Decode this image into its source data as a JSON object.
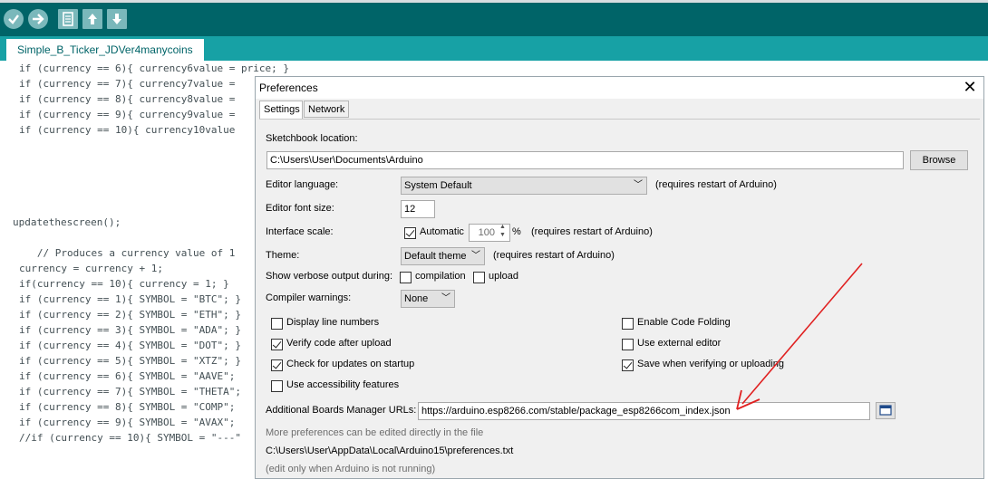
{
  "ide": {
    "tab_name": "Simple_B_Ticker_JDVer4manycoins",
    "code_lines": [
      "if (currency == 6){ currency6value = price; }",
      "if (currency == 7){ currency7value = ",
      "if (currency == 8){ currency8value = ",
      "if (currency == 9){ currency9value = ",
      "if (currency == 10){ currency10value ",
      "updatethescreen();",
      "   // Produces a currency value of 1 ",
      "currency = currency + 1;",
      "if(currency == 10){ currency = 1; }",
      "if (currency == 1){ SYMBOL = \"BTC\"; }",
      "if (currency == 2){ SYMBOL = \"ETH\"; }",
      "if (currency == 3){ SYMBOL = \"ADA\"; }",
      "if (currency == 4){ SYMBOL = \"DOT\"; }",
      "if (currency == 5){ SYMBOL = \"XTZ\"; }",
      "if (currency == 6){ SYMBOL = \"AAVE\";",
      "if (currency == 7){ SYMBOL = \"THETA\";",
      "if (currency == 8){ SYMBOL = \"COMP\";",
      "if (currency == 9){ SYMBOL = \"AVAX\";",
      "//if (currency == 10){ SYMBOL = \"---\""
    ]
  },
  "dialog": {
    "title": "Preferences",
    "tabs": [
      "Settings",
      "Network"
    ],
    "sketchbook_label": "Sketchbook location:",
    "sketchbook_value": "C:\\Users\\User\\Documents\\Arduino",
    "browse_label": "Browse",
    "editor_language_label": "Editor language:",
    "editor_language_value": "System Default",
    "requires_restart": "(requires restart of Arduino)",
    "font_size_label": "Editor font size:",
    "font_size_value": "12",
    "interface_scale_label": "Interface scale:",
    "automatic_label": "Automatic",
    "scale_value": "100",
    "percent": "%",
    "theme_label": "Theme:",
    "theme_value": "Default theme",
    "verbose_label": "Show verbose output during:",
    "compilation_label": "compilation",
    "upload_label": "upload",
    "warnings_label": "Compiler warnings:",
    "warnings_value": "None",
    "options_left": [
      {
        "label": "Display line numbers",
        "checked": false
      },
      {
        "label": "Verify code after upload",
        "checked": true
      },
      {
        "label": "Check for updates on startup",
        "checked": true
      },
      {
        "label": "Use accessibility features",
        "checked": false
      }
    ],
    "options_right": [
      {
        "label": "Enable Code Folding",
        "checked": false
      },
      {
        "label": "Use external editor",
        "checked": false
      },
      {
        "label": "Save when verifying or uploading",
        "checked": true
      }
    ],
    "boards_url_label": "Additional Boards Manager URLs:",
    "boards_url_value": "https://arduino.esp8266.com/stable/package_esp8266com_index.json",
    "more_prefs": "More preferences can be edited directly in the file",
    "prefs_path": "C:\\Users\\User\\AppData\\Local\\Arduino15\\preferences.txt",
    "edit_note": "(edit only when Arduino is not running)"
  },
  "colors": {
    "toolbar": "#006468",
    "tabbar": "#17a1a5",
    "annotation_arrow": "#e02020"
  }
}
